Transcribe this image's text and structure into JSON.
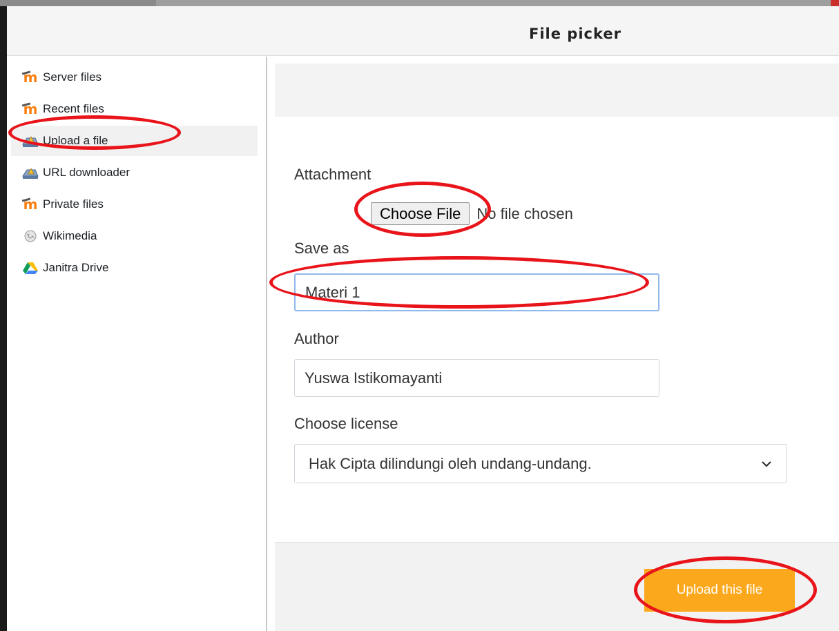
{
  "dialog": {
    "title": "File picker"
  },
  "sidebar": {
    "items": [
      {
        "label": "Server files",
        "icon": "moodle-icon"
      },
      {
        "label": "Recent files",
        "icon": "moodle-icon"
      },
      {
        "label": "Upload a file",
        "icon": "upload-icon",
        "active": true
      },
      {
        "label": "URL downloader",
        "icon": "url-downloader-icon"
      },
      {
        "label": "Private files",
        "icon": "moodle-icon"
      },
      {
        "label": "Wikimedia",
        "icon": "wikimedia-icon"
      },
      {
        "label": "Janitra Drive",
        "icon": "google-drive-icon"
      }
    ]
  },
  "form": {
    "attachment_label": "Attachment",
    "choose_file_button": "Choose File",
    "no_file_text": "No file chosen",
    "save_as_label": "Save as",
    "save_as_value": "Materi 1",
    "author_label": "Author",
    "author_value": "Yuswa Istikomayanti",
    "license_label": "Choose license",
    "license_value": "Hak Cipta dilindungi oleh undang-undang."
  },
  "footer": {
    "upload_button": "Upload this file"
  },
  "colors": {
    "accent": "#fba81c",
    "annotation": "#e8141a",
    "moodle_orange": "#f98012"
  }
}
